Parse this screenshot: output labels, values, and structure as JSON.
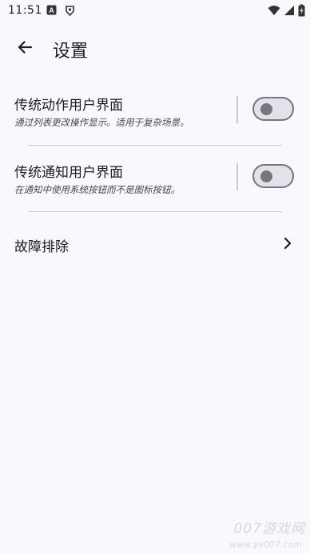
{
  "status_bar": {
    "time": "11:51",
    "notification_icons": [
      "font-icon",
      "tag-icon"
    ],
    "system_icons": [
      "wifi-icon",
      "signal-icon",
      "battery-charging-icon"
    ]
  },
  "app_bar": {
    "back_icon": "arrow-back-icon",
    "title": "设置"
  },
  "settings": {
    "items": [
      {
        "title": "传统动作用户界面",
        "subtitle": "通过列表更改操作显示。适用于复杂场景。",
        "toggle": false
      },
      {
        "title": "传统通知用户界面",
        "subtitle": "在通知中使用系统按钮而不是图标按钮。",
        "toggle": false
      }
    ],
    "troubleshoot": {
      "title": "故障排除",
      "icon": "chevron-right-icon"
    }
  },
  "watermark": {
    "text": "007游戏网",
    "url": "www.yx007.com"
  },
  "colors": {
    "background": "#f8f9fd",
    "switch_track": "#e2e2ea",
    "switch_outline": "#75767e",
    "divider": "#c9cad2"
  }
}
